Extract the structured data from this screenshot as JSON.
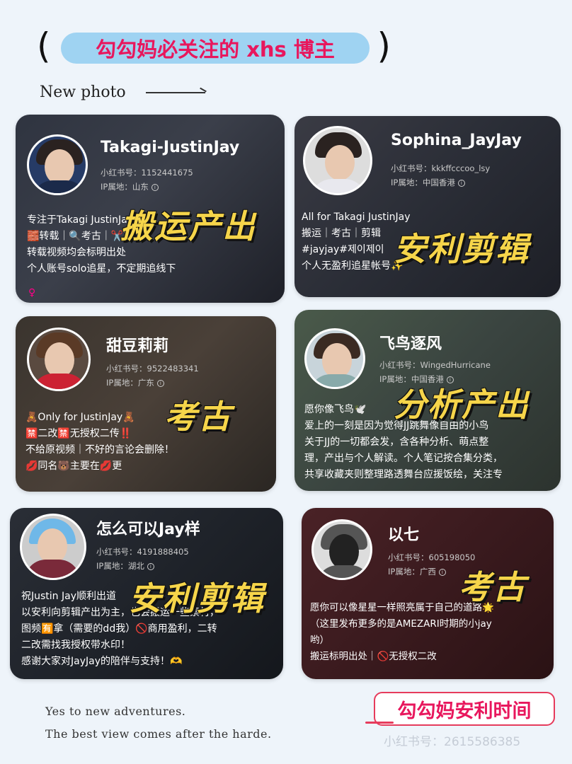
{
  "header": {
    "paren_left": "(",
    "paren_right": ")",
    "title": "勾勾妈必关注的 xhs 博主",
    "subtitle": "New photo"
  },
  "cards": [
    {
      "name": "Takagi-JustinJay",
      "id_line": "小红书号：1152441675",
      "ip_line": "IP属地：山东",
      "bio": [
        "专注于Takagi JustinJay",
        "🧱转载｜🔍考古｜✂️产出",
        "转载视频均会标明出处",
        "个人账号solo追星，不定期追线下"
      ],
      "stamp": "搬运产出",
      "gender": "♀"
    },
    {
      "name": "Sophina_JayJay",
      "id_line": "小红书号：kkkffcccoo_lsy",
      "ip_line": "IP属地：中国香港",
      "bio": [
        "All for Takagi JustinJay",
        "搬运｜考古｜剪辑",
        "#jayjay#제이제이",
        "个人无盈利追星帐号✨"
      ],
      "stamp": "安利剪辑"
    },
    {
      "name": "甜豆莉莉",
      "id_line": "小红书号：9522483341",
      "ip_line": "IP属地：广东",
      "bio": [
        "🧸Only for JustinJay🧸",
        "🈲二改🈲无授权二传‼️",
        "不给原视频｜不好的言论会删除！",
        "💋同名🐻主要在💋更"
      ],
      "stamp": "考古"
    },
    {
      "name": "飞鸟逐风",
      "id_line": "小红书号：WingedHurricane",
      "ip_line": "IP属地：中国香港",
      "bio": [
        "愿你像飞鸟🕊️",
        "爱上的一刻是因为觉得JJ跳舞像自由的小鸟",
        "关于JJ的一切都会发，含各种分析、萌点整",
        "理，产出与个人解读。个人笔记按合集分类，",
        "共享收藏夹则整理路透舞台应援饭绘，关注专"
      ],
      "stamp": "分析产出"
    },
    {
      "name": "怎么可以Jay样",
      "id_line": "小红书号：4191888405",
      "ip_line": "IP属地：湖北",
      "bio": [
        "祝Justin Jay顺利出道",
        "以安利向剪辑产出为主，也会搬运一些素材，",
        "图频🈶拿（需要的dd我）🚫商用盈利，二转",
        "二改需找我授权带水印！",
        "感谢大家对JayJay的陪伴与支持！🫶"
      ],
      "stamp": "安利剪辑"
    },
    {
      "name": "以七",
      "id_line": "小红书号：605198050",
      "ip_line": "IP属地：广西",
      "bio": [
        "愿你可以像星星一样照亮属于自己的道路🌟",
        "（这里发布更多的是AMEZARI时期的小jay",
        "哟）",
        "搬运标明出处｜🚫无授权二改"
      ],
      "stamp": "考古"
    }
  ],
  "footer": {
    "line1": "Yes to new adventures.",
    "line2": "The best view comes after the harde.",
    "signature": "勾勾妈安利时间",
    "watermark": "小红书号：2615586385"
  },
  "colors": {
    "page_bg": "#eef4fa",
    "title_pill": "#9fd3f2",
    "title_text": "#e8175d",
    "stamp": "#f6d54a"
  }
}
